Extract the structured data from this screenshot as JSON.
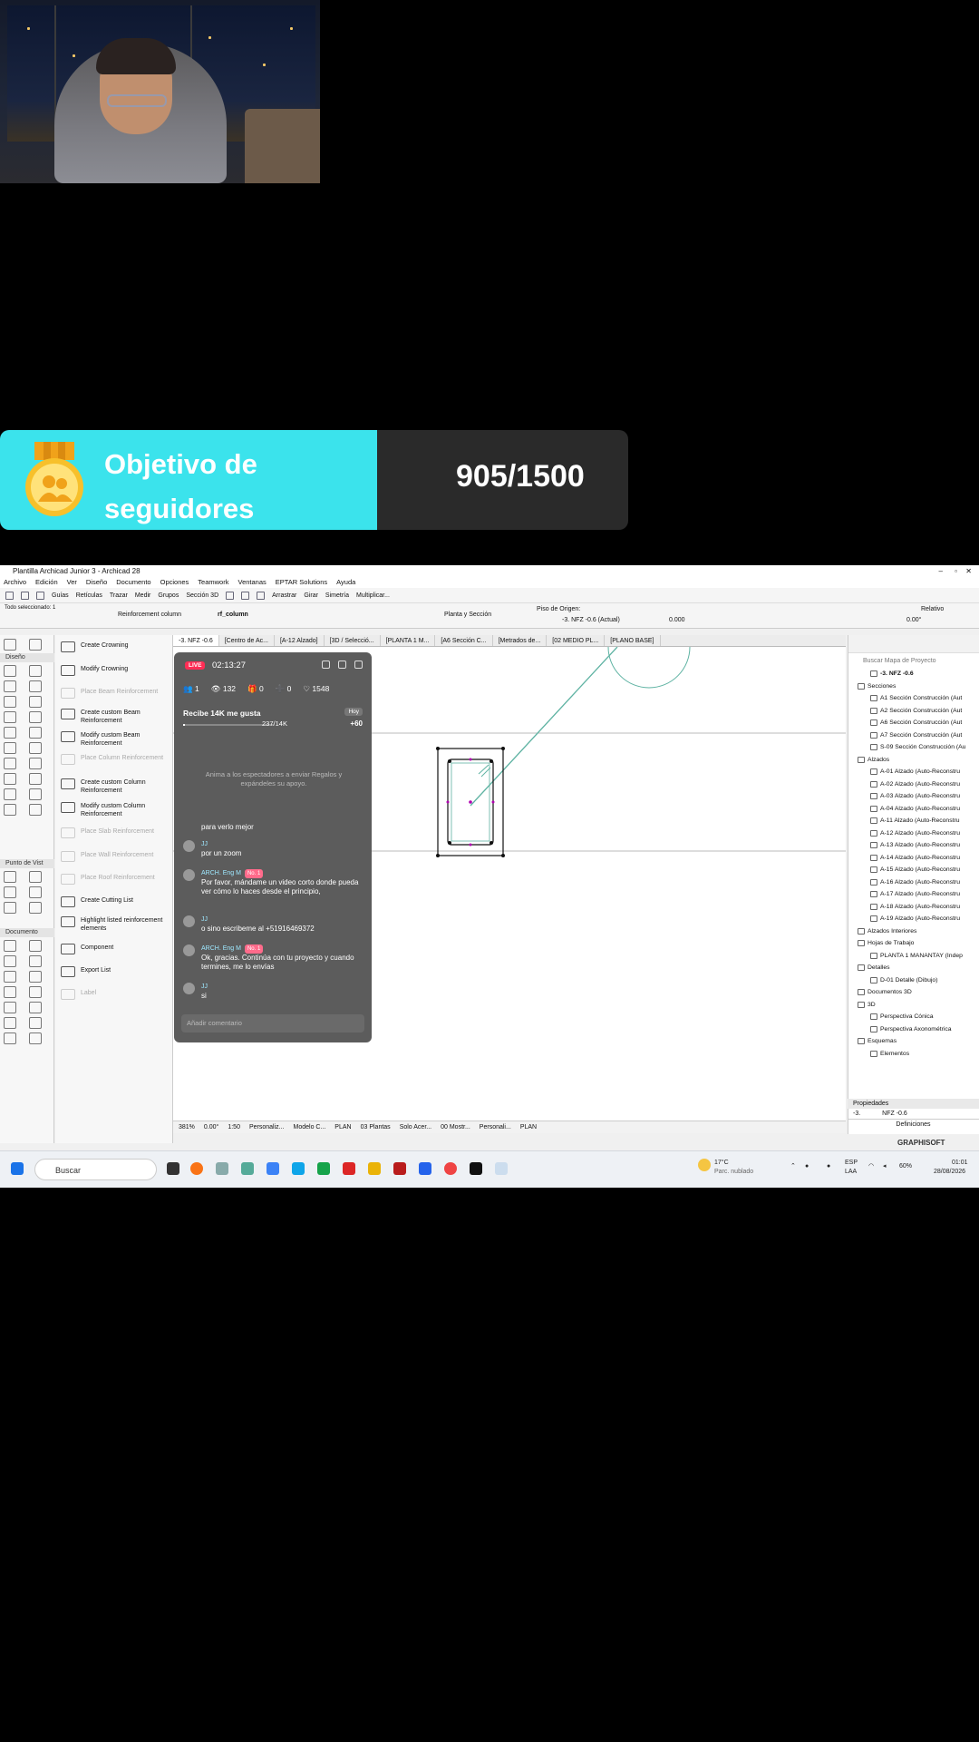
{
  "goal": {
    "title_line1": "Objetivo de",
    "title_line2": "seguidores",
    "count": "905/1500"
  },
  "app": {
    "title": "Plantilla Archicad Junior 3 - Archicad 28",
    "menu": [
      "Archivo",
      "Edición",
      "Ver",
      "Diseño",
      "Documento",
      "Opciones",
      "Teamwork",
      "Ventanas",
      "EPTAR Solutions",
      "Ayuda"
    ],
    "toolbar": [
      "Guías",
      "Retículas",
      "Trazar",
      "Medir",
      "Grupos",
      "Sección 3D",
      "Arrastrar",
      "Girar",
      "Simetría",
      "Multiplicar..."
    ],
    "info": {
      "selected": "Todo seleccionado: 1",
      "tool": "Reinforcement column",
      "layer": "rf_column",
      "view": "Planta y Sección",
      "origin_label": "Piso de Origen:",
      "origin_value": "-3. NFZ -0.6 (Actual)",
      "elev": "0.000",
      "relative": "Relativo",
      "angle": "0.00°"
    },
    "palettes": {
      "design": "Diseño",
      "viewpoint": "Punto de Vist",
      "document": "Documento"
    },
    "rebar_items": [
      {
        "label": "Create Crowning",
        "enabled": true
      },
      {
        "label": "Modify Crowning",
        "enabled": true
      },
      {
        "label": "Place Beam Reinforcement",
        "enabled": false
      },
      {
        "label": "Create custom Beam Reinforcement",
        "enabled": true
      },
      {
        "label": "Modify custom Beam Reinforcement",
        "enabled": true
      },
      {
        "label": "Place Column Reinforcement",
        "enabled": false
      },
      {
        "label": "Create custom Column Reinforcement",
        "enabled": true
      },
      {
        "label": "Modify custom Column Reinforcement",
        "enabled": true
      },
      {
        "label": "Place Slab Reinforcement",
        "enabled": false
      },
      {
        "label": "Place Wall Reinforcement",
        "enabled": false
      },
      {
        "label": "Place Roof Reinforcement",
        "enabled": false
      },
      {
        "label": "Create Cutting List",
        "enabled": true
      },
      {
        "label": "Highlight listed reinforcement elements",
        "enabled": true
      },
      {
        "label": "Component",
        "enabled": true
      },
      {
        "label": "Export List",
        "enabled": true
      },
      {
        "label": "Label",
        "enabled": false
      }
    ],
    "tabs": [
      "-3. NFZ -0.6",
      "[Centro de Ac...",
      "[A-12 Alzado]",
      "[3D / Selecció...",
      "[PLANTA 1 M...",
      "[A6 Sección C...",
      "[Metrados de...",
      "[02 MEDIO PL...",
      "[PLANO BASE]"
    ],
    "status": [
      "381%",
      "0.00°",
      "1:50",
      "Personaliz...",
      "Modelo C...",
      "PLAN",
      "03 Plantas",
      "Solo Acer...",
      "00 Mostr...",
      "Personali...",
      "PLAN"
    ],
    "navigator": {
      "search_placeholder": "Buscar Mapa de Proyecto",
      "items": [
        {
          "label": "-3. NFZ -0.6",
          "level": 2,
          "bold": true
        },
        {
          "label": "Secciones",
          "level": 1,
          "bold": false
        },
        {
          "label": "A1 Sección Construcción (Aut",
          "level": 2,
          "bold": false
        },
        {
          "label": "A2 Sección Construcción (Aut",
          "level": 2,
          "bold": false
        },
        {
          "label": "A6 Sección Construcción (Aut",
          "level": 2,
          "bold": false
        },
        {
          "label": "A7 Sección Construcción (Aut",
          "level": 2,
          "bold": false
        },
        {
          "label": "S-09 Sección Construcción (Au",
          "level": 2,
          "bold": false
        },
        {
          "label": "Alzados",
          "level": 1,
          "bold": false
        },
        {
          "label": "A-01 Alzado (Auto-Reconstru",
          "level": 2,
          "bold": false
        },
        {
          "label": "A-02 Alzado (Auto-Reconstru",
          "level": 2,
          "bold": false
        },
        {
          "label": "A-03 Alzado (Auto-Reconstru",
          "level": 2,
          "bold": false
        },
        {
          "label": "A-04 Alzado (Auto-Reconstru",
          "level": 2,
          "bold": false
        },
        {
          "label": "A-11 Alzado (Auto-Reconstru",
          "level": 2,
          "bold": false
        },
        {
          "label": "A-12 Alzado (Auto-Reconstru",
          "level": 2,
          "bold": false
        },
        {
          "label": "A-13 Alzado (Auto-Reconstru",
          "level": 2,
          "bold": false
        },
        {
          "label": "A-14 Alzado (Auto-Reconstru",
          "level": 2,
          "bold": false
        },
        {
          "label": "A-15 Alzado (Auto-Reconstru",
          "level": 2,
          "bold": false
        },
        {
          "label": "A-16 Alzado (Auto-Reconstru",
          "level": 2,
          "bold": false
        },
        {
          "label": "A-17 Alzado (Auto-Reconstru",
          "level": 2,
          "bold": false
        },
        {
          "label": "A-18 Alzado (Auto-Reconstru",
          "level": 2,
          "bold": false
        },
        {
          "label": "A-19 Alzado (Auto-Reconstru",
          "level": 2,
          "bold": false
        },
        {
          "label": "Alzados Interiores",
          "level": 1,
          "bold": false
        },
        {
          "label": "Hojas de Trabajo",
          "level": 1,
          "bold": false
        },
        {
          "label": "PLANTA 1 MANANTAY (Indep",
          "level": 2,
          "bold": false
        },
        {
          "label": "Detalles",
          "level": 1,
          "bold": false
        },
        {
          "label": "D-01 Detalle (Dibujo)",
          "level": 2,
          "bold": false
        },
        {
          "label": "Documentos 3D",
          "level": 1,
          "bold": false
        },
        {
          "label": "3D",
          "level": 1,
          "bold": false
        },
        {
          "label": "Perspectiva Cónica",
          "level": 2,
          "bold": false
        },
        {
          "label": "Perspectiva Axonométrica",
          "level": 2,
          "bold": false
        },
        {
          "label": "Esquemas",
          "level": 1,
          "bold": false
        },
        {
          "label": "Elementos",
          "level": 2,
          "bold": false
        }
      ],
      "props_title": "Propiedades",
      "props_id": "-3.",
      "props_value": "NFZ -0.6",
      "definitions": "Definiciones",
      "brand": "GRAPHISOFT"
    }
  },
  "chat": {
    "live": "LIVE",
    "timer": "02:13:27",
    "stats": [
      "1",
      "132",
      "0",
      "0",
      "1548"
    ],
    "goal_text": "Recibe 14K me gusta",
    "today": "Hoy",
    "progress_text": "237/14K",
    "progress_fraction": 0.017,
    "bonus": "+60",
    "invite": "Anima a los espectadores a enviar Regalos y expándeles su apoyo.",
    "messages": [
      {
        "user": "",
        "text": "para verlo mejor",
        "badge": ""
      },
      {
        "user": "JJ",
        "text": "por un zoom",
        "badge": ""
      },
      {
        "user": "ARCH. Eng M",
        "text": "Por favor, mándame un video corto donde pueda ver cómo lo haces desde el principio,",
        "badge": "No. 1"
      },
      {
        "user": "JJ",
        "text": "o sino escribeme al +51916469372",
        "badge": ""
      },
      {
        "user": "ARCH. Eng M",
        "text": "Ok, gracias. Continúa con tu proyecto y cuando termines, me lo envías",
        "badge": "No. 1"
      },
      {
        "user": "JJ",
        "text": "si",
        "badge": ""
      }
    ],
    "comment_placeholder": "Añadir comentario"
  },
  "taskbar": {
    "search": "Buscar",
    "weather_temp": "17°C",
    "weather_desc": "Parc. nublado",
    "lang": "ESP",
    "lang2": "LAA",
    "battery": "60%",
    "time": "01:01",
    "date": "28/08/2026"
  },
  "colors": {
    "goal_cyan": "#3be3ec",
    "live_red": "#ff2d55",
    "chat_bg": "#5c5c5c",
    "drawing_teal": "#5fb3a3"
  }
}
